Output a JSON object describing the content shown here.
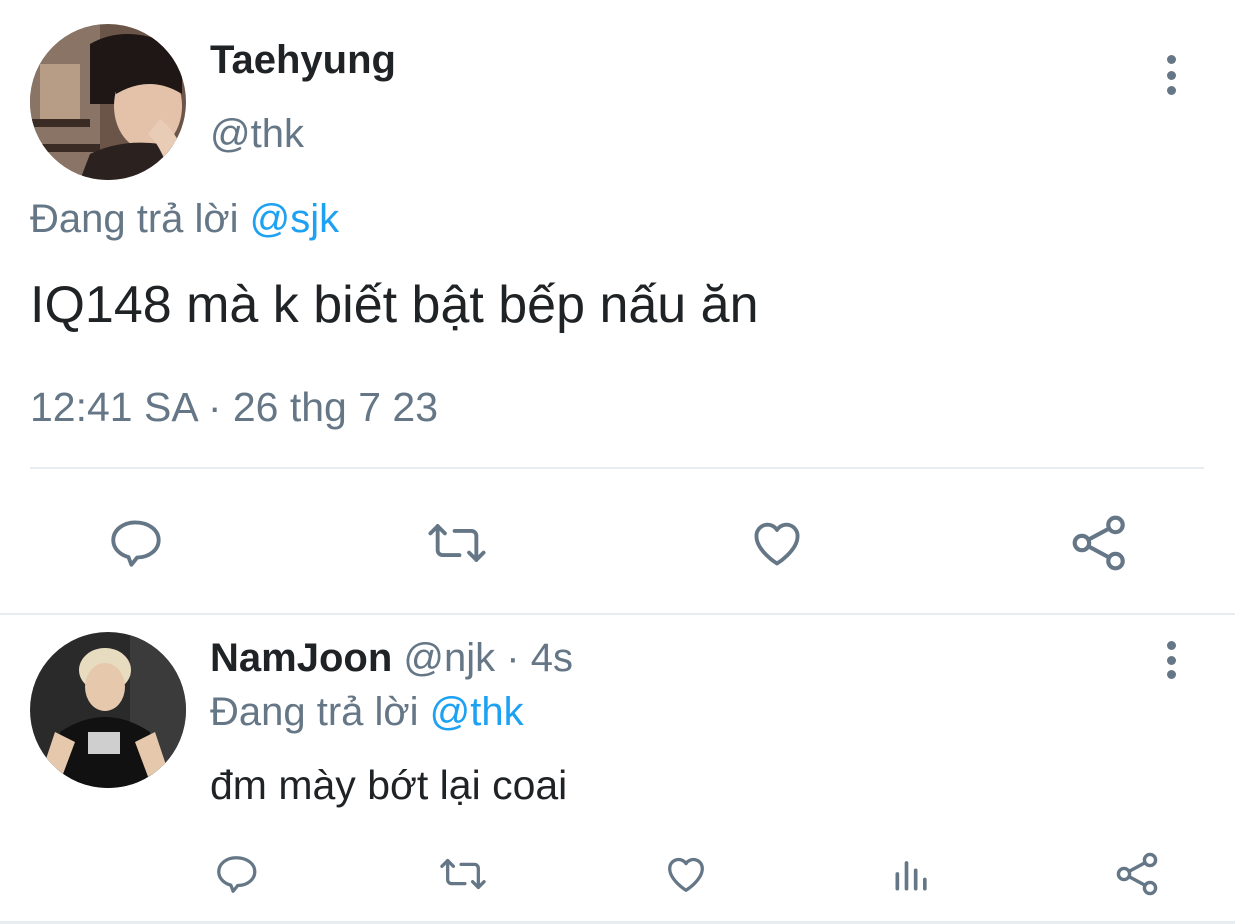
{
  "main_tweet": {
    "display_name": "Taehyung",
    "handle": "@thk",
    "replying_prefix": "Đang trả lời",
    "replying_to": "@sjk",
    "text": "IQ148 mà k biết bật bếp nấu ăn",
    "timestamp": "12:41 SA · 26 thg 7 23",
    "actions": [
      "reply-icon",
      "retweet-icon",
      "like-icon",
      "share-icon"
    ]
  },
  "reply_tweet": {
    "display_name": "NamJoon",
    "handle": "@njk",
    "separator": "·",
    "age": "4s",
    "replying_prefix": "Đang trả lời",
    "replying_to": "@thk",
    "text": "đm mày bớt lại coai",
    "actions": [
      "reply-icon",
      "retweet-icon",
      "like-icon",
      "analytics-icon",
      "share-icon"
    ]
  },
  "colors": {
    "text_primary": "#1f2326",
    "text_secondary": "#657786",
    "mention": "#1da1f2",
    "divider": "#e6ecf0"
  }
}
